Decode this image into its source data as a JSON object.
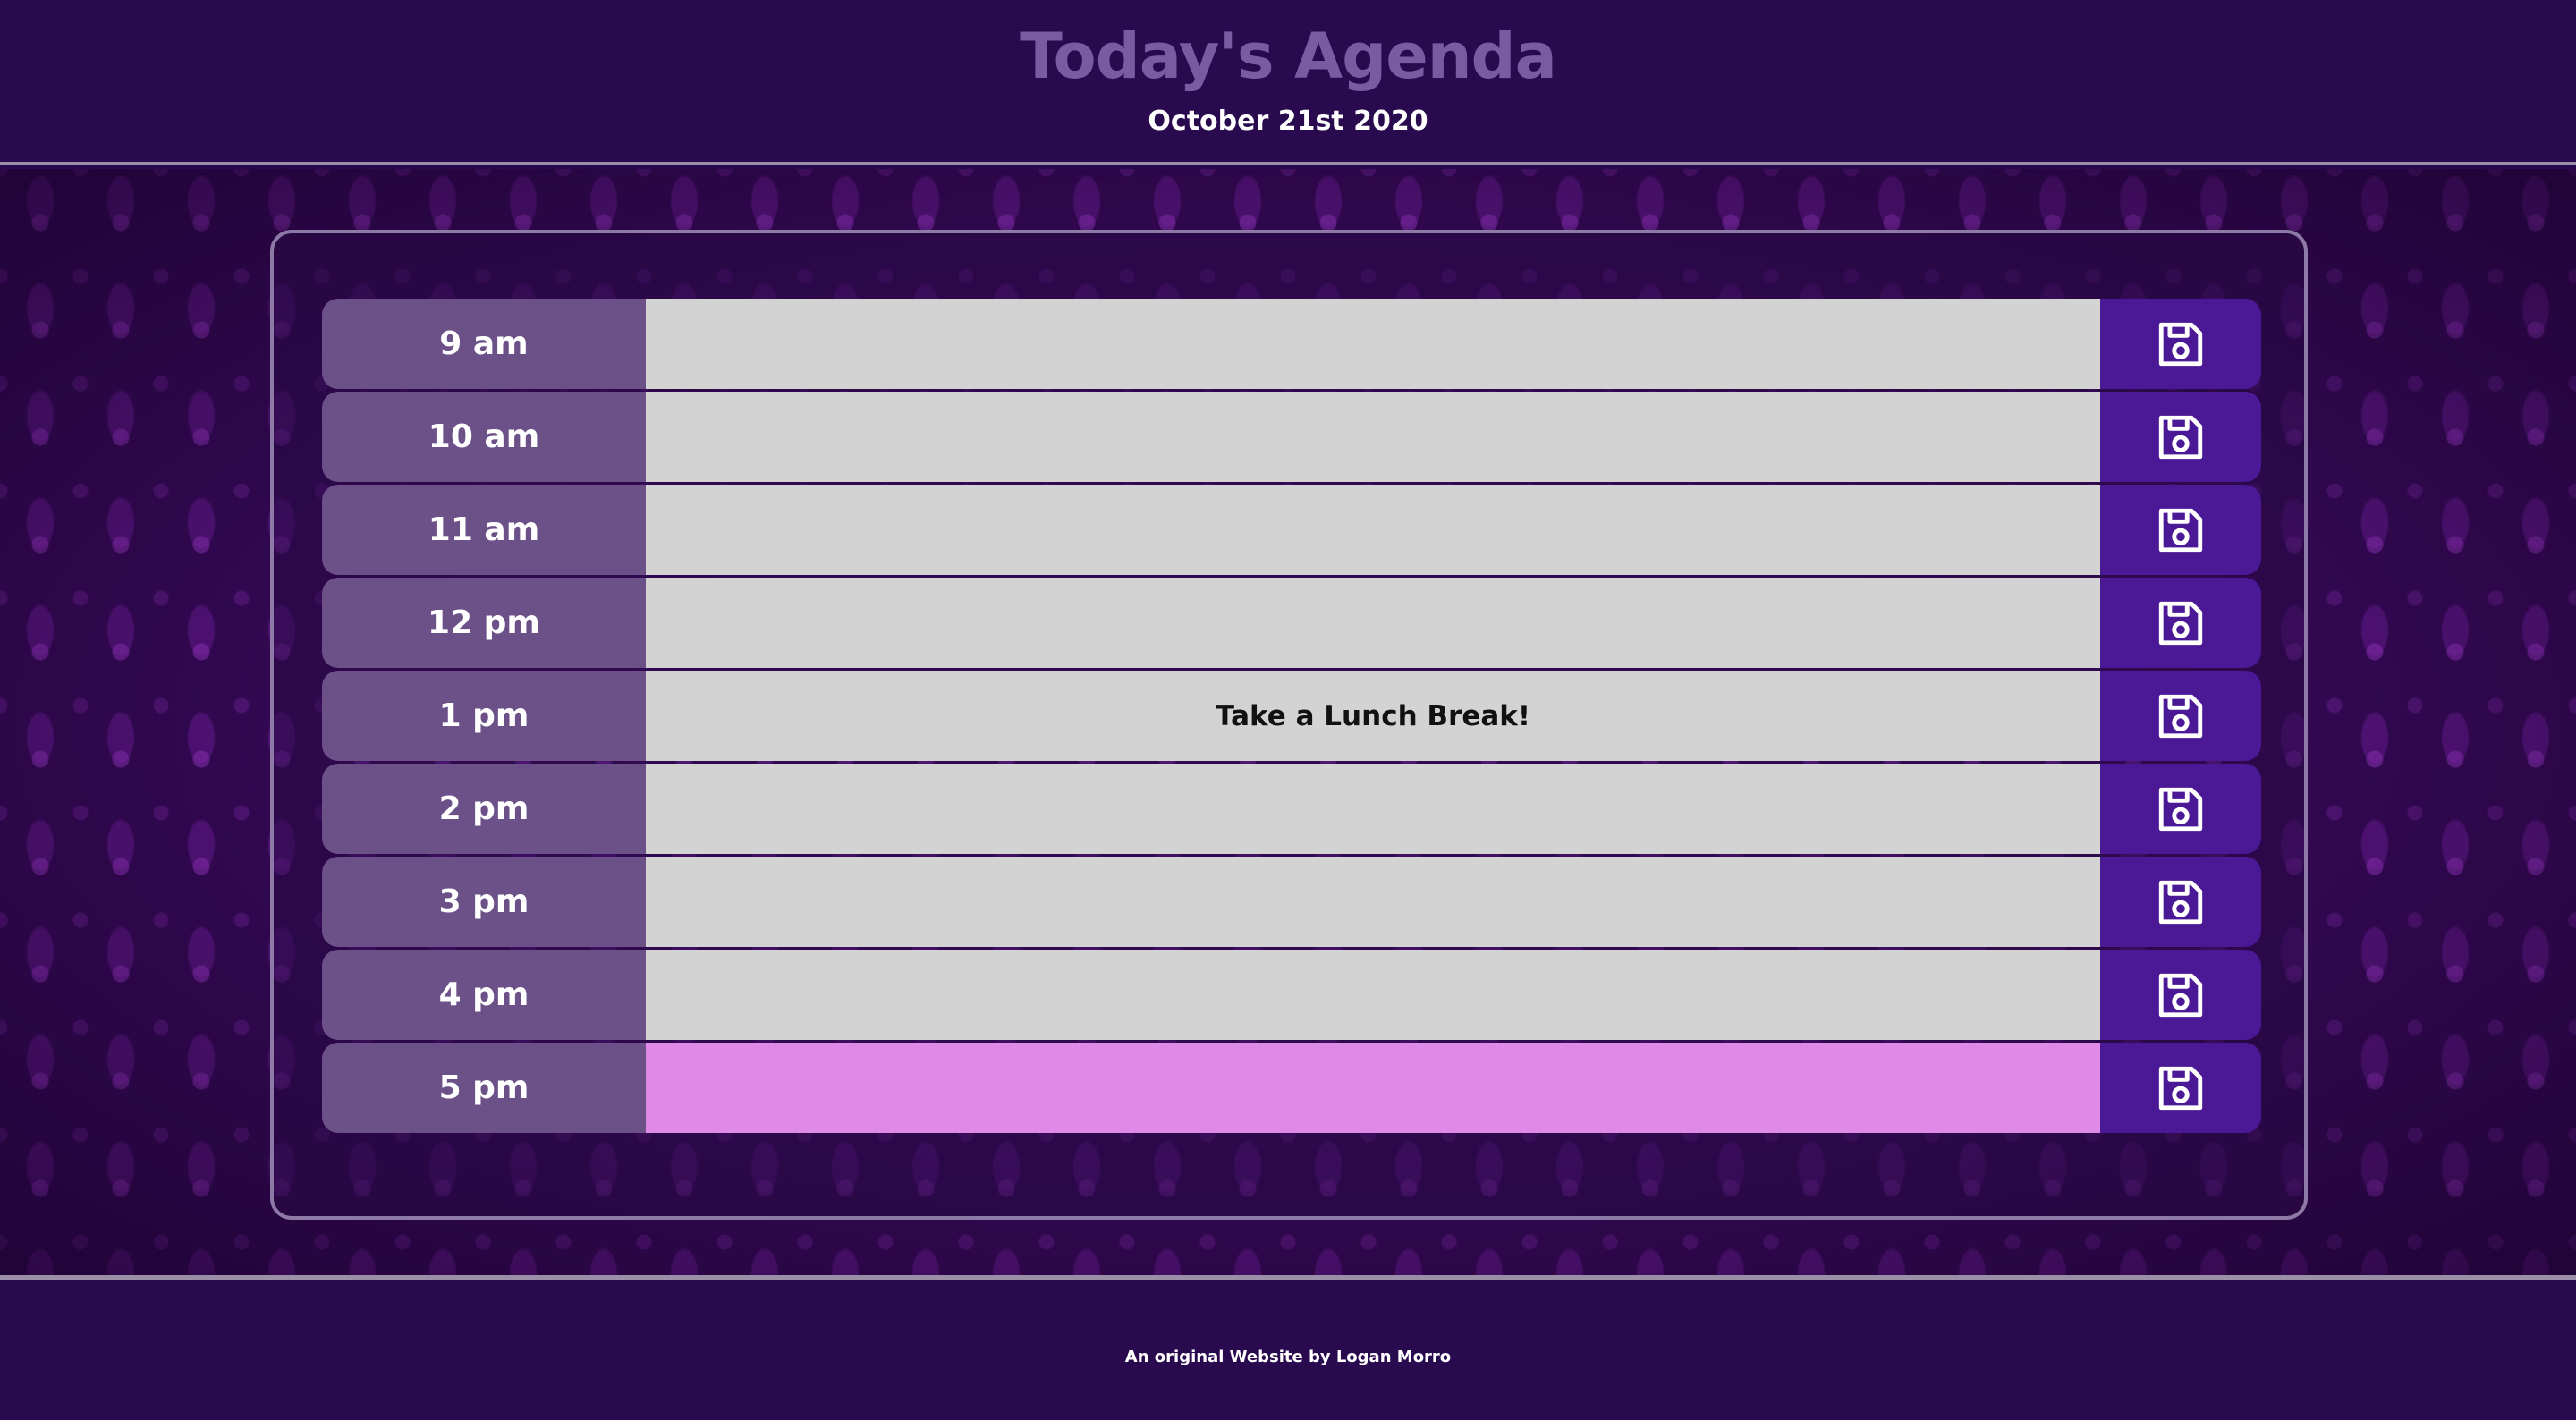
{
  "header": {
    "title": "Today's Agenda",
    "date": "October 21st 2020"
  },
  "rows": [
    {
      "hour": "9 am",
      "text": "",
      "state": "past"
    },
    {
      "hour": "10 am",
      "text": "",
      "state": "past"
    },
    {
      "hour": "11 am",
      "text": "",
      "state": "past"
    },
    {
      "hour": "12 pm",
      "text": "",
      "state": "past"
    },
    {
      "hour": "1 pm",
      "text": "Take a Lunch Break!",
      "state": "past"
    },
    {
      "hour": "2 pm",
      "text": "",
      "state": "past"
    },
    {
      "hour": "3 pm",
      "text": "",
      "state": "past"
    },
    {
      "hour": "4 pm",
      "text": "",
      "state": "past"
    },
    {
      "hour": "5 pm",
      "text": "",
      "state": "present"
    }
  ],
  "save_icon": "floppy-disk-icon",
  "colors": {
    "header_bg": "#2a0a4e",
    "title": "#7a5aa0",
    "hour_bg": "#6c5088",
    "past_bg": "#d3d3d3",
    "present_bg": "#e08ae8",
    "save_bg": "#4b1896"
  },
  "footer": {
    "credit": "An original Website by Logan Morro"
  }
}
